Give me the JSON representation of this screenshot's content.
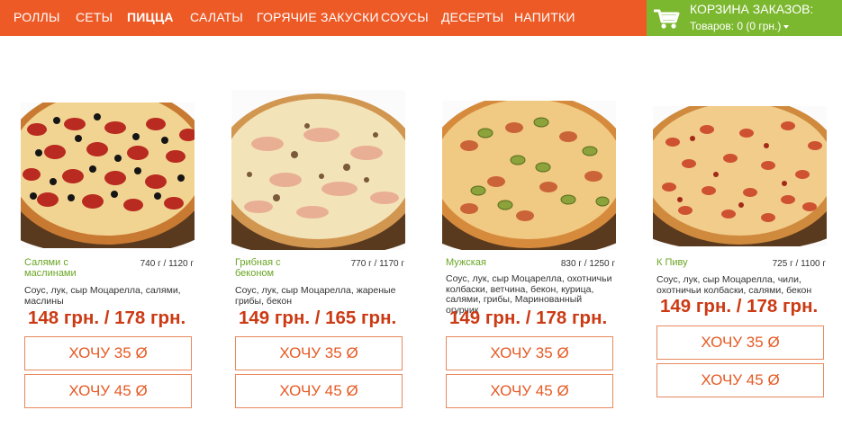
{
  "nav": {
    "items": [
      {
        "label": "РОЛЛЫ",
        "active": false
      },
      {
        "label": "СЕТЫ",
        "active": false
      },
      {
        "label": "ПИЦЦА",
        "active": true
      },
      {
        "label": "САЛАТЫ",
        "active": false
      },
      {
        "label": "ГОРЯЧИЕ ЗАКУСКИ",
        "active": false
      },
      {
        "label": "СОУСЫ",
        "active": false
      },
      {
        "label": "ДЕСЕРТЫ",
        "active": false
      },
      {
        "label": "НАПИТКИ",
        "active": false
      }
    ]
  },
  "cart": {
    "icon": "shopping-cart-icon",
    "title": "КОРЗИНА ЗАКАЗОВ:",
    "summary": "Товаров: 0 (0 грн.)"
  },
  "products": [
    {
      "name": "Салями с маслинами",
      "weight": "740 г / 1120 г",
      "description": "Соус, лук, сыр Моцарелла, салями, маслины",
      "price": "148 грн. / 178 грн.",
      "buttons": [
        "ХОЧУ 35 Ø",
        "ХОЧУ 45 Ø"
      ],
      "image": "pizza-salami-olives"
    },
    {
      "name": "Грибная с беконом",
      "weight": "770 г / 1170 г",
      "description": "Соус, лук, сыр Моцарелла, жареные грибы, бекон",
      "price": "149 грн. / 165 грн.",
      "buttons": [
        "ХОЧУ 35 Ø",
        "ХОЧУ 45 Ø"
      ],
      "image": "pizza-mushroom-bacon"
    },
    {
      "name": "Мужская",
      "weight": "830 г / 1250 г",
      "description": "Соус, лук, сыр Моцарелла, охотничьи колбаски, ветчина, бекон, курица, салями, грибы, Маринованный огурчик",
      "price": "149 грн. / 178 грн.",
      "buttons": [
        "ХОЧУ 35 Ø",
        "ХОЧУ 45 Ø"
      ],
      "image": "pizza-mens"
    },
    {
      "name": "К Пиву",
      "weight": "725 г / 1100 г",
      "description": "Соус, лук, сыр Моцарелла, чили, охотничьи колбаски, салями, бекон",
      "price": "149 грн. / 178 грн.",
      "buttons": [
        "ХОЧУ 35 Ø",
        "ХОЧУ 45 Ø"
      ],
      "image": "pizza-beer"
    }
  ]
}
